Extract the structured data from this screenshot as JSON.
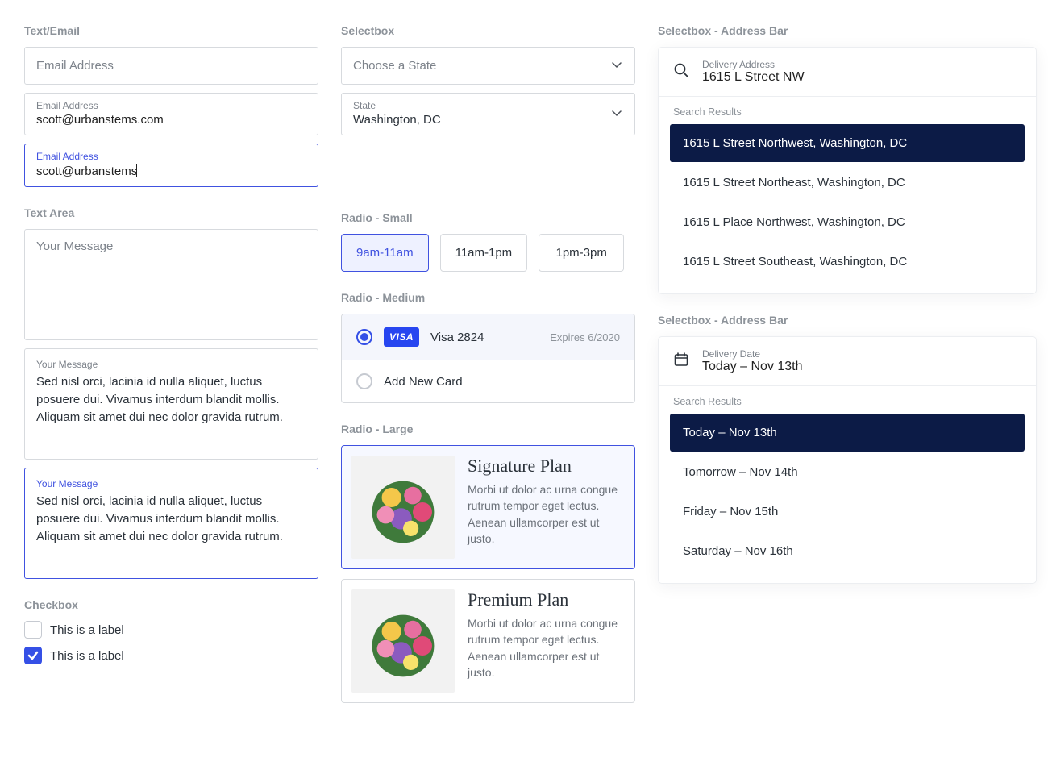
{
  "col1": {
    "text_email_label": "Text/Email",
    "email1_placeholder": "Email Address",
    "email2_label": "Email Address",
    "email2_value": "scott@urbanstems.com",
    "email3_label": "Email Address",
    "email3_value": "scott@urbanstems",
    "textarea_label": "Text Area",
    "ta1_placeholder": "Your Message",
    "ta2_label": "Your Message",
    "ta2_body": "Sed nisl orci, lacinia id nulla aliquet, luctus posuere dui. Vivamus interdum blandit mollis. Aliquam sit amet dui nec dolor gravida rutrum.",
    "ta3_label": "Your Message",
    "ta3_body": "Sed nisl orci, lacinia id nulla aliquet, luctus posuere dui. Vivamus interdum blandit mollis. Aliquam sit amet dui nec dolor gravida rutrum.",
    "checkbox_label": "Checkbox",
    "check1_text": "This is a label",
    "check2_text": "This is a label"
  },
  "col2": {
    "selectbox_label": "Selectbox",
    "select1_placeholder": "Choose a State",
    "select2_label": "State",
    "select2_value": "Washington, DC",
    "radio_small_label": "Radio - Small",
    "radio_small": [
      "9am-11am",
      "11am-1pm",
      "1pm-3pm"
    ],
    "radio_medium_label": "Radio - Medium",
    "card_name": "Visa 2824",
    "card_expiry": "Expires 6/2020",
    "card_badge": "VISA",
    "add_card": "Add New Card",
    "radio_large_label": "Radio - Large",
    "plan1_title": "Signature Plan",
    "plan1_desc": "Morbi ut dolor ac urna congue rutrum tempor eget lectus. Aenean ullamcorper est ut justo.",
    "plan2_title": "Premium Plan",
    "plan2_desc": "Morbi ut dolor ac urna congue rutrum tempor eget lectus. Aenean ullamcorper est ut justo."
  },
  "col3": {
    "addr_bar_label": "Selectbox - Address Bar",
    "addr_field_label": "Delivery Address",
    "addr_field_value": "1615 L Street NW",
    "results_label": "Search Results",
    "addr_results": [
      "1615 L Street Northwest, Washington, DC",
      "1615 L Street Northeast, Washington, DC",
      "1615 L Place Northwest, Washington, DC",
      "1615 L Street Southeast, Washington, DC"
    ],
    "date_bar_label": "Selectbox - Address Bar",
    "date_field_label": "Delivery Date",
    "date_field_value": "Today – Nov 13th",
    "date_results": [
      "Today – Nov 13th",
      "Tomorrow – Nov 14th",
      "Friday – Nov 15th",
      "Saturday – Nov 16th"
    ]
  }
}
